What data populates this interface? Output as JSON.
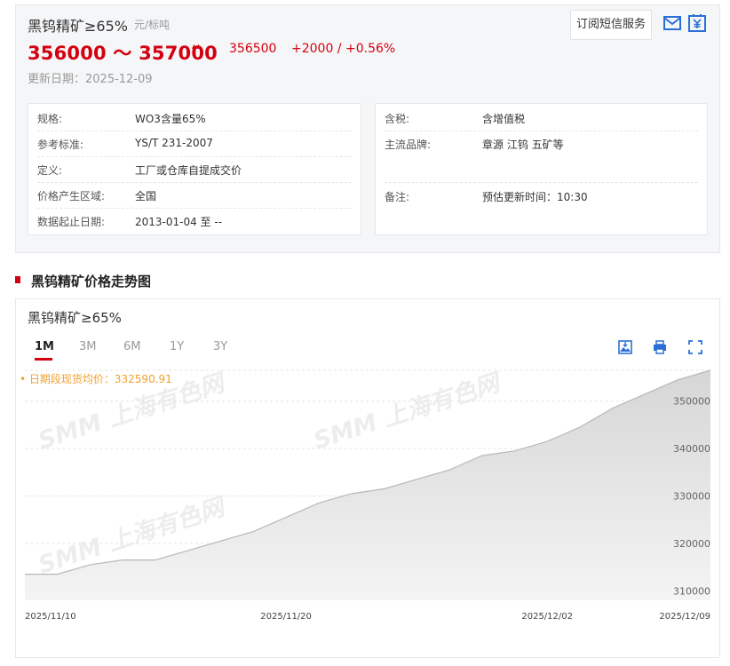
{
  "product": {
    "name": "黑钨精矿≥65%",
    "unit": "元/标吨",
    "price_range": "356000 ～ 357000",
    "avg_price": "356500",
    "change": "+2000  /  +0.56%",
    "update_date": "更新日期：2025-12-09",
    "subscribe_label": "订阅短信服务"
  },
  "specs_left": [
    {
      "label": "规格:",
      "value": "WO3含量65%"
    },
    {
      "label": "参考标准:",
      "value": "YS/T 231-2007"
    },
    {
      "label": "定义:",
      "value": "工厂或仓库自提成交价"
    },
    {
      "label": "价格产生区域:",
      "value": "全国"
    },
    {
      "label": "数据起止日期:",
      "value": "2013-01-04 至 --"
    }
  ],
  "specs_right": [
    {
      "label": "含税:",
      "value": "含增值税"
    },
    {
      "label": "主流品牌:",
      "value": "章源 江钨 五矿等"
    },
    {
      "label": "备注:",
      "value": "预估更新时间：10:30"
    }
  ],
  "section_title": "黑钨精矿价格走势图",
  "chart_panel": {
    "name": "黑钨精矿≥65%",
    "tabs": [
      "1M",
      "3M",
      "6M",
      "1Y",
      "3Y"
    ],
    "active_tab": "1M",
    "avg_note": "• 日期段现货均价：332590.91",
    "watermark": "SMM 上海有色网"
  },
  "colors": {
    "accent_red": "#d4000f",
    "note_orange": "#f0a030",
    "line": "#b8b8b8"
  },
  "chart_data": {
    "type": "area",
    "x": [
      "2025-11-10",
      "2025-11-11",
      "2025-11-12",
      "2025-11-13",
      "2025-11-14",
      "2025-11-17",
      "2025-11-18",
      "2025-11-19",
      "2025-11-20",
      "2025-11-21",
      "2025-11-24",
      "2025-11-25",
      "2025-11-26",
      "2025-11-27",
      "2025-11-28",
      "2025-12-01",
      "2025-12-02",
      "2025-12-03",
      "2025-12-04",
      "2025-12-05",
      "2025-12-08",
      "2025-12-09"
    ],
    "values": [
      313500,
      313500,
      315500,
      316500,
      316500,
      318500,
      320500,
      322500,
      325500,
      328500,
      330500,
      331500,
      333500,
      335500,
      338500,
      339500,
      341500,
      344500,
      348500,
      351500,
      354500,
      356500
    ],
    "x_tick_labels": [
      "2025/11/10",
      "2025/11/20",
      "2025/12/02",
      "2025/12/09"
    ],
    "x_tick_indices": [
      0,
      8,
      16,
      21
    ],
    "y_ticks": [
      310000,
      320000,
      330000,
      340000,
      350000
    ],
    "ylim": [
      308000,
      356500
    ],
    "grid": true,
    "legend": "none"
  }
}
